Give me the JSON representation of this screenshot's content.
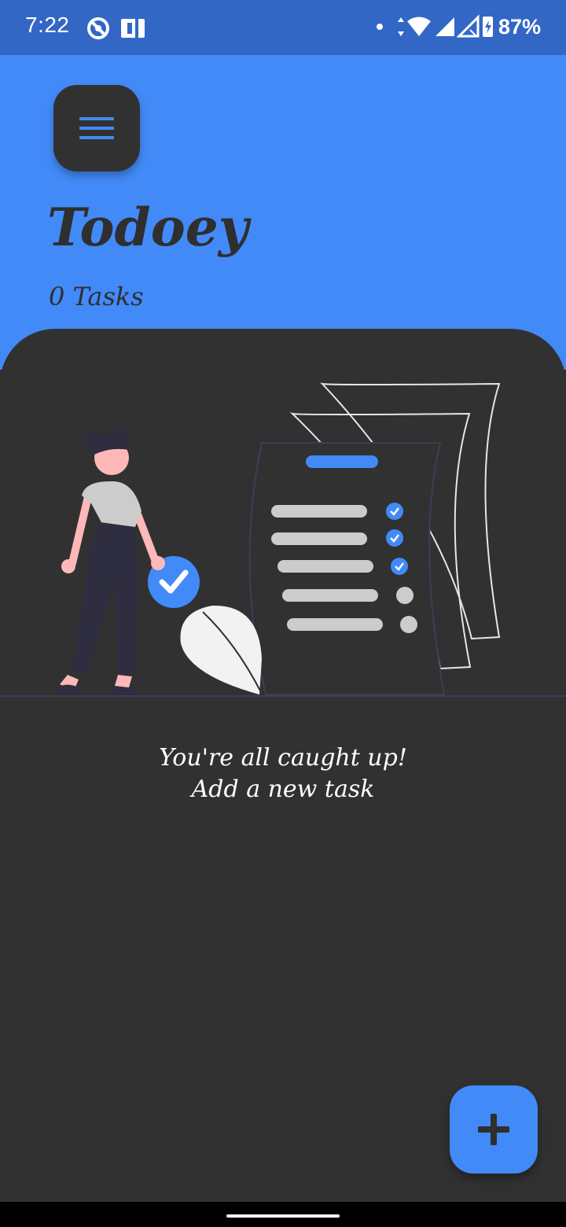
{
  "status_bar": {
    "time": "7:22",
    "battery_percent": "87%",
    "icons": [
      "do-not-disturb-icon",
      "nfc-icon",
      "notification-dot-icon",
      "data-arrows-icon",
      "wifi-icon",
      "signal-icon",
      "signal-no-sim-icon",
      "battery-charging-icon"
    ]
  },
  "header": {
    "title": "Todoey",
    "task_count": "0 Tasks",
    "menu_icon": "hamburger-menu-icon"
  },
  "empty_state": {
    "line1": "You're all caught up!",
    "line2": "Add a new task"
  },
  "fab": {
    "icon": "plus-icon"
  },
  "colors": {
    "primary": "#428af8",
    "status_bar": "#3267c6",
    "surface": "#313131",
    "text_dark": "#2f2f2f",
    "text_light": "#ffffff"
  }
}
